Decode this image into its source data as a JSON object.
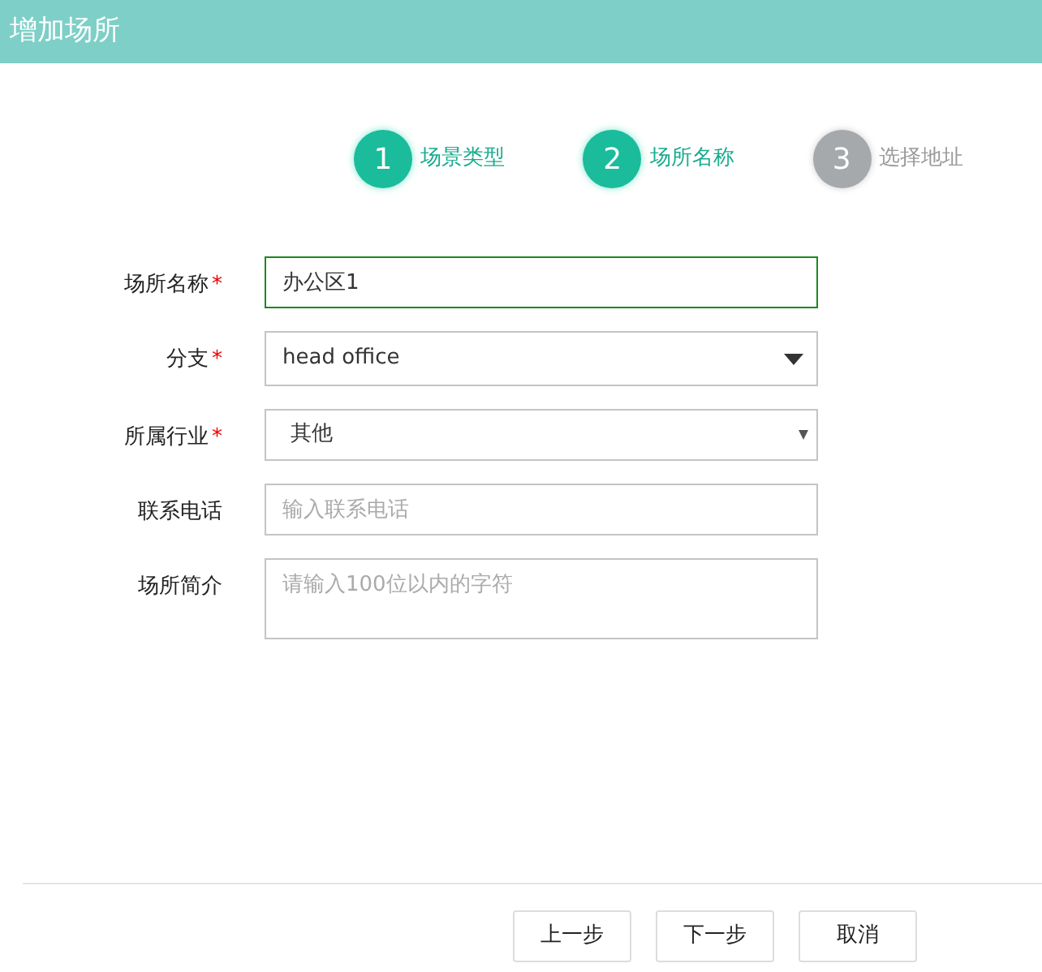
{
  "window": {
    "title": "增加场所"
  },
  "steps": [
    {
      "number": "1",
      "label": "场景类型",
      "active": true
    },
    {
      "number": "2",
      "label": "场所名称",
      "active": true
    },
    {
      "number": "3",
      "label": "选择地址",
      "active": false
    }
  ],
  "fields": [
    {
      "kind": "input",
      "label": "场所名称",
      "required_mark": "*",
      "value": "办公区1",
      "focused": true
    },
    {
      "kind": "select",
      "label": "分支",
      "required_mark": "*",
      "value": "head office",
      "focused": false
    },
    {
      "kind": "native-select",
      "label": "所属行业",
      "required_mark": "*",
      "value": "其他",
      "focused": false
    },
    {
      "kind": "input",
      "label": "联系电话",
      "placeholder": "输入联系电话",
      "focused": false
    },
    {
      "kind": "textarea",
      "label": "场所简介",
      "placeholder": "请输入100位以内的字符",
      "focused": false
    }
  ],
  "buttons": [
    "上一步",
    "下一步",
    "取消"
  ]
}
